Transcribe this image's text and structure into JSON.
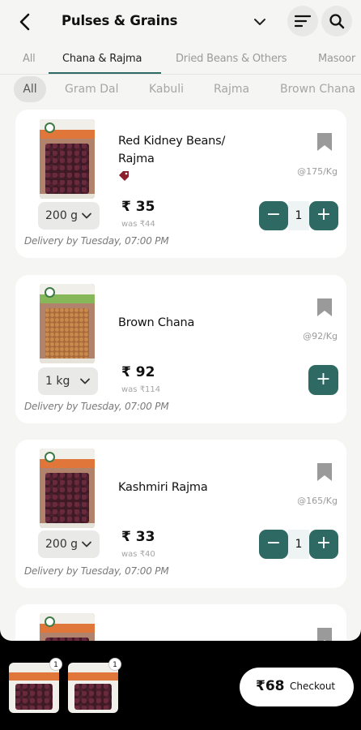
{
  "header": {
    "title": "Pulses & Grains",
    "back_icon": "back-arrow-icon",
    "dropdown_icon": "chevron-down-icon",
    "sort_icon": "sort-icon",
    "search_icon": "search-icon"
  },
  "tabs": [
    {
      "label": "All",
      "active": false
    },
    {
      "label": "Chana & Rajma",
      "active": true
    },
    {
      "label": "Dried Beans & Others",
      "active": false
    },
    {
      "label": "Masoor",
      "active": false
    }
  ],
  "chips": [
    {
      "label": "All",
      "active": true
    },
    {
      "label": "Gram Dal",
      "active": false
    },
    {
      "label": "Kabuli",
      "active": false
    },
    {
      "label": "Rajma",
      "active": false
    },
    {
      "label": "Brown Chana",
      "active": false
    }
  ],
  "products": [
    {
      "name_line1": "Red Kidney Beans/",
      "name_line2": "Rajma",
      "unit_price": "@175/Kg",
      "weight": "200 g",
      "price": "₹ 35",
      "was": "was ₹44",
      "delivery": "Delivery by Tuesday, 07:00 PM",
      "quantity": "1",
      "in_cart": true,
      "has_tag": true
    },
    {
      "name_line1": "Brown Chana",
      "unit_price": "@92/Kg",
      "weight": "1 kg",
      "price": "₹ 92",
      "was": "was ₹114",
      "delivery": "Delivery by Tuesday, 07:00 PM",
      "in_cart": false
    },
    {
      "name_line1": "Kashmiri Rajma",
      "unit_price": "@165/Kg",
      "weight": "200 g",
      "price": "₹ 33",
      "was": "was ₹40",
      "delivery": "Delivery by Tuesday, 07:00 PM",
      "quantity": "1",
      "in_cart": true
    }
  ],
  "stepper": {
    "minus": "−",
    "plus": "+"
  },
  "cart": {
    "items": [
      {
        "count": "1"
      },
      {
        "count": "1"
      }
    ],
    "total": "₹68",
    "checkout_label": "Checkout"
  },
  "colors": {
    "accent": "#2e6a63",
    "background": "#f5f5f3",
    "card": "#ffffff",
    "bottom_bar": "#000000"
  }
}
